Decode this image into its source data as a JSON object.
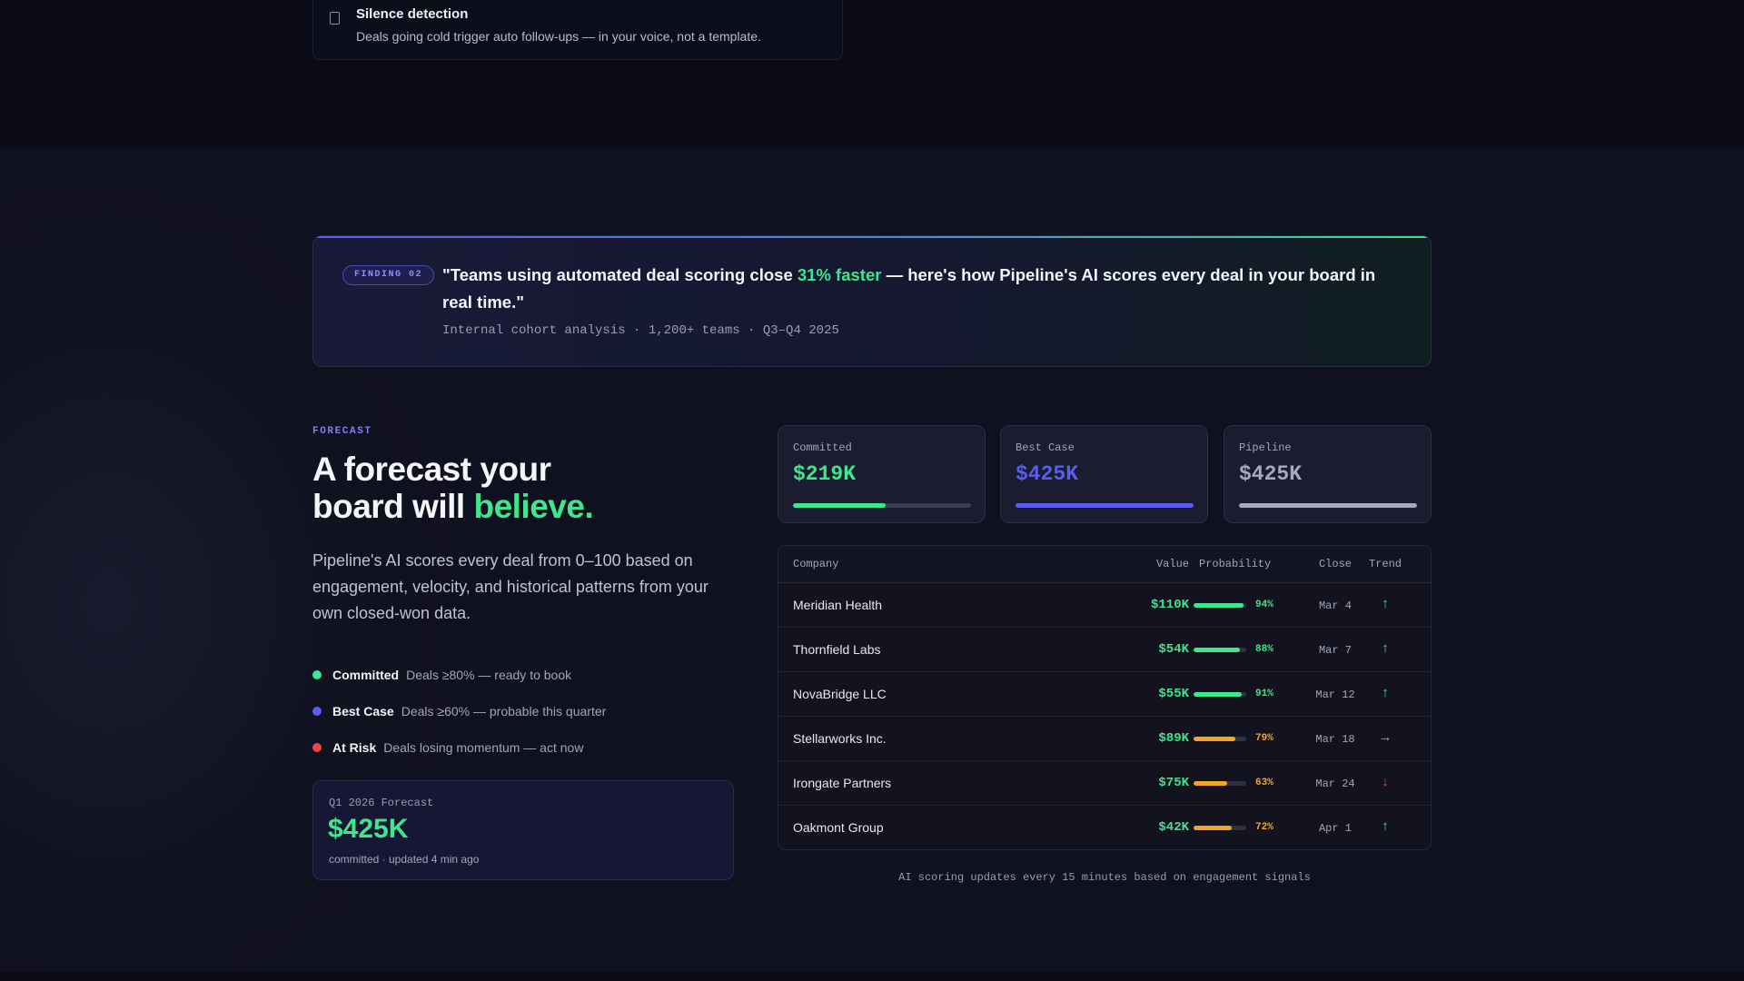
{
  "silence": {
    "icon": "document-icon",
    "title": "Silence detection",
    "description": "Deals going cold trigger auto follow-ups — in your voice, not a template."
  },
  "finding": {
    "badge": "FINDING 02",
    "quote_pre": "\"Teams using automated deal scoring close ",
    "quote_highlight": "31% faster",
    "quote_post": " — here's how Pipeline's AI scores every deal in your board in real time.\"",
    "source": "Internal cohort analysis · 1,200+ teams · Q3–Q4 2025"
  },
  "forecast": {
    "eyebrow": "FORECAST",
    "headline_line1": "A forecast your",
    "headline_line2_pre": "board will ",
    "headline_accent": "believe.",
    "subcopy": "Pipeline's AI scores every deal from 0–100 based on engagement, velocity, and historical patterns from your own closed-won data.",
    "legend": [
      {
        "name": "Committed",
        "desc": "Deals ≥80% — ready to book",
        "color": "#3ee68c"
      },
      {
        "name": "Best Case",
        "desc": "Deals ≥60% — probable this quarter",
        "color": "#5b5cf0"
      },
      {
        "name": "At Risk",
        "desc": "Deals losing momentum — act now",
        "color": "#ef4444"
      }
    ],
    "card": {
      "label": "Q1 2026 Forecast",
      "value": "$425K",
      "sub": "committed · updated 4 min ago"
    }
  },
  "stats": [
    {
      "label": "Committed",
      "value": "$219K",
      "color": "#3ee68c",
      "fill": 0.52
    },
    {
      "label": "Best Case",
      "value": "$425K",
      "color": "#5b5cf0",
      "fill": 1.0
    },
    {
      "label": "Pipeline",
      "value": "$425K",
      "color": "#a8aabb",
      "fill": 1.0
    }
  ],
  "table": {
    "headers": {
      "company": "Company",
      "value": "Value",
      "probability": "Probability",
      "close": "Close",
      "trend": "Trend"
    },
    "rows": [
      {
        "company": "Meridian Health",
        "value": "$110K",
        "prob": 0.94,
        "pct": "94%",
        "close": "Mar 4",
        "trend": "↑",
        "trend_color": "#3ee68c",
        "bar_color": "#3ee68c"
      },
      {
        "company": "Thornfield Labs",
        "value": "$54K",
        "prob": 0.88,
        "pct": "88%",
        "close": "Mar 7",
        "trend": "↑",
        "trend_color": "#3ee68c",
        "bar_color": "#3ee68c"
      },
      {
        "company": "NovaBridge LLC",
        "value": "$55K",
        "prob": 0.91,
        "pct": "91%",
        "close": "Mar 12",
        "trend": "↑",
        "trend_color": "#3ee68c",
        "bar_color": "#3ee68c"
      },
      {
        "company": "Stellarworks Inc.",
        "value": "$89K",
        "prob": 0.79,
        "pct": "79%",
        "close": "Mar 18",
        "trend": "→",
        "trend_color": "#a3a5b8",
        "bar_color": "#f5a524"
      },
      {
        "company": "Irongate Partners",
        "value": "$75K",
        "prob": 0.63,
        "pct": "63%",
        "close": "Mar 24",
        "trend": "↓",
        "trend_color": "#ef4444",
        "bar_color": "#f5a524"
      },
      {
        "company": "Oakmont Group",
        "value": "$42K",
        "prob": 0.72,
        "pct": "72%",
        "close": "Apr 1",
        "trend": "↑",
        "trend_color": "#3ee68c",
        "bar_color": "#f5a524"
      }
    ],
    "note": "AI scoring updates every 15 minutes based on engagement signals"
  }
}
